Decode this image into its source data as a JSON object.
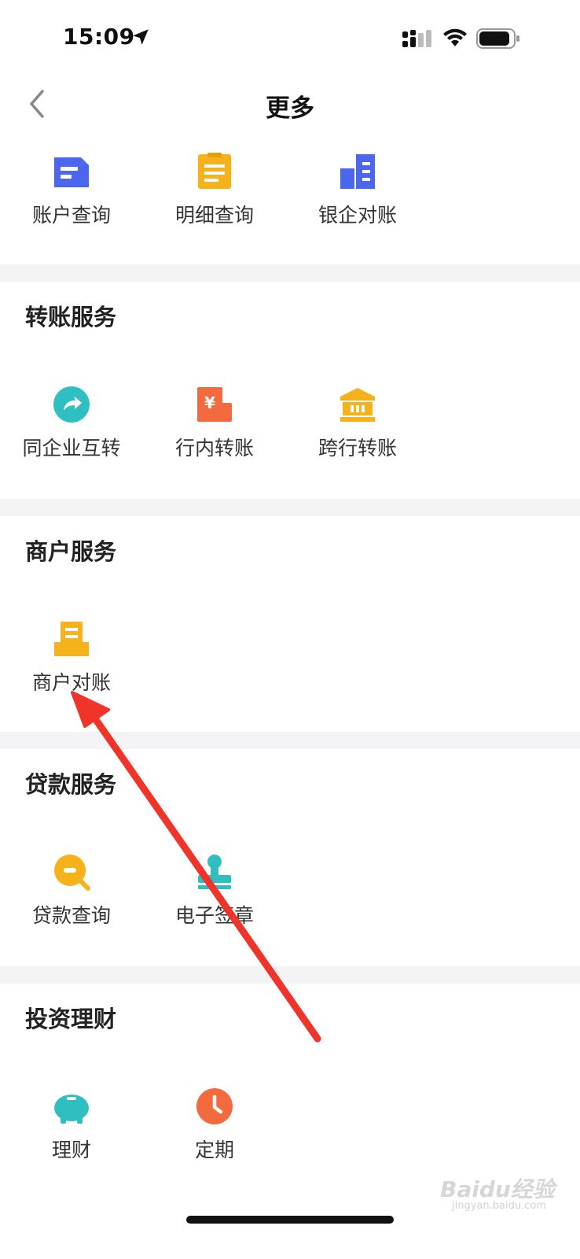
{
  "status_bar": {
    "time": "15:09"
  },
  "header": {
    "title": "更多"
  },
  "top_section": {
    "items": [
      {
        "label": "账户查询",
        "icon": "account-doc-icon",
        "color": "#4b67f0"
      },
      {
        "label": "明细查询",
        "icon": "detail-list-icon",
        "color": "#f6b21a"
      },
      {
        "label": "银企对账",
        "icon": "bank-building-icon",
        "color": "#4b67f0"
      }
    ]
  },
  "transfer_section": {
    "title": "转账服务",
    "items": [
      {
        "label": "同企业互转",
        "icon": "share-arrow-icon",
        "color": "#2fbfc0"
      },
      {
        "label": "行内转账",
        "icon": "yen-card-icon",
        "color": "#f26a3d"
      },
      {
        "label": "跨行转账",
        "icon": "bank-icon",
        "color": "#f6b21a"
      }
    ]
  },
  "merchant_section": {
    "title": "商户服务",
    "items": [
      {
        "label": "商户对账",
        "icon": "inbox-tray-icon",
        "color": "#f6b21a"
      }
    ]
  },
  "loan_section": {
    "title": "贷款服务",
    "items": [
      {
        "label": "贷款查询",
        "icon": "search-minus-icon",
        "color": "#f6b21a"
      },
      {
        "label": "电子签章",
        "icon": "stamp-icon",
        "color": "#2fbfc0"
      }
    ]
  },
  "invest_section": {
    "title": "投资理财",
    "items": [
      {
        "label": "理财",
        "icon": "piggy-bank-icon",
        "color": "#2fbfc0"
      },
      {
        "label": "定期",
        "icon": "clock-icon",
        "color": "#f26a3d"
      }
    ]
  },
  "watermark": {
    "text": "Baidu经验",
    "sub": "jingyan.baidu.com"
  }
}
